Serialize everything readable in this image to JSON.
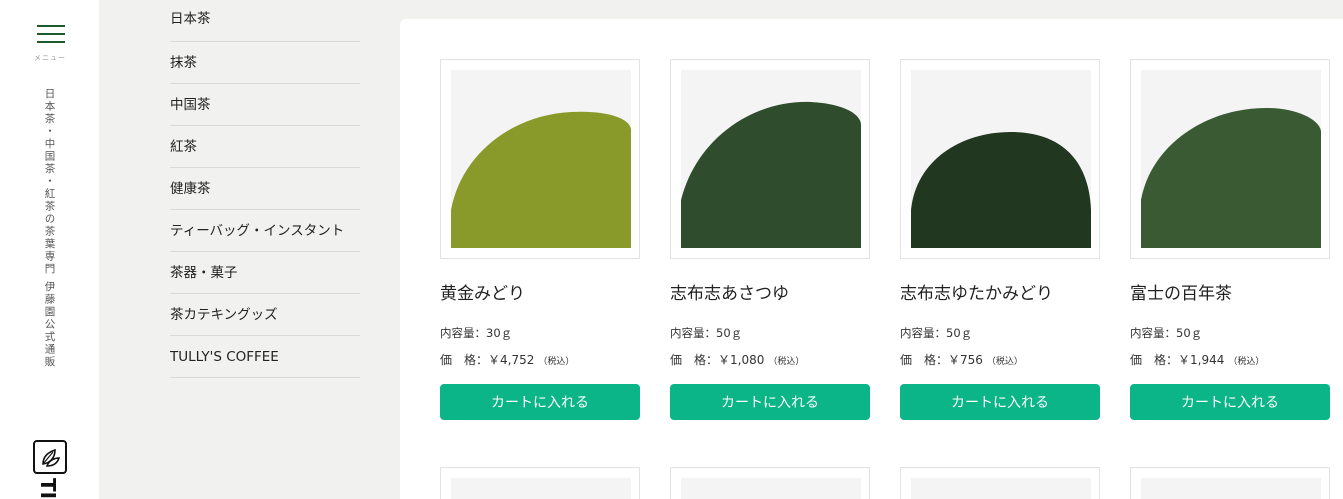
{
  "rail": {
    "menu_label": "メニュー",
    "tagline": "日本茶・中国茶・紅茶の茶葉専門 伊藤園公式通販",
    "brand": "TI"
  },
  "categories": [
    {
      "label": "日本茶"
    },
    {
      "label": "抹茶"
    },
    {
      "label": "中国茶"
    },
    {
      "label": "紅茶"
    },
    {
      "label": "健康茶"
    },
    {
      "label": "ティーバッグ・インスタント"
    },
    {
      "label": "茶器・菓子"
    },
    {
      "label": "茶カテキングッズ"
    },
    {
      "label": "TULLY'S COFFEE"
    }
  ],
  "products": [
    {
      "name": "黄金みどり",
      "volume": "内容量：30ｇ",
      "price_label": "価　格：",
      "price": "￥4,752",
      "tax": "（税込）",
      "cart_label": "カートに入れる",
      "leaf_color": "#8a9a2a"
    },
    {
      "name": "志布志あさつゆ",
      "volume": "内容量：50ｇ",
      "price_label": "価　格：",
      "price": "￥1,080",
      "tax": "（税込）",
      "cart_label": "カートに入れる",
      "leaf_color": "#2f4d2c"
    },
    {
      "name": "志布志ゆたかみどり",
      "volume": "内容量：50ｇ",
      "price_label": "価　格：",
      "price": "￥756",
      "tax": "（税込）",
      "cart_label": "カートに入れる",
      "leaf_color": "#22371f"
    },
    {
      "name": "富士の百年茶",
      "volume": "内容量：50ｇ",
      "price_label": "価　格：",
      "price": "￥1,944",
      "tax": "（税込）",
      "cart_label": "カートに入れる",
      "leaf_color": "#3a5a33"
    }
  ]
}
